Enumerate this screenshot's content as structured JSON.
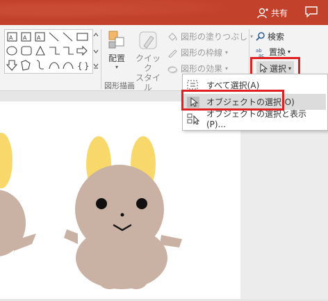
{
  "titlebar": {
    "share_label": "共有"
  },
  "ribbon": {
    "arrange_label": "配置",
    "quick_style_label_1": "クイック",
    "quick_style_label_2": "スタイル",
    "shape_fill_label": "図形の塗りつぶし",
    "shape_outline_label": "図形の枠線",
    "shape_effects_label": "図形の効果",
    "drawing_group_label": "図形描画",
    "find_label": "検索",
    "replace_label": "置換",
    "select_label": "選択"
  },
  "select_menu": {
    "items": [
      {
        "label": "すべて選択(A)"
      },
      {
        "label": "オブジェクトの選択(O)"
      },
      {
        "label": "オブジェクトの選択と表示(P)..."
      }
    ]
  },
  "colors": {
    "titlebar": "#c2412b",
    "highlight": "#e02020",
    "ear": "#f9d86b",
    "body": "#c9b2a3"
  }
}
